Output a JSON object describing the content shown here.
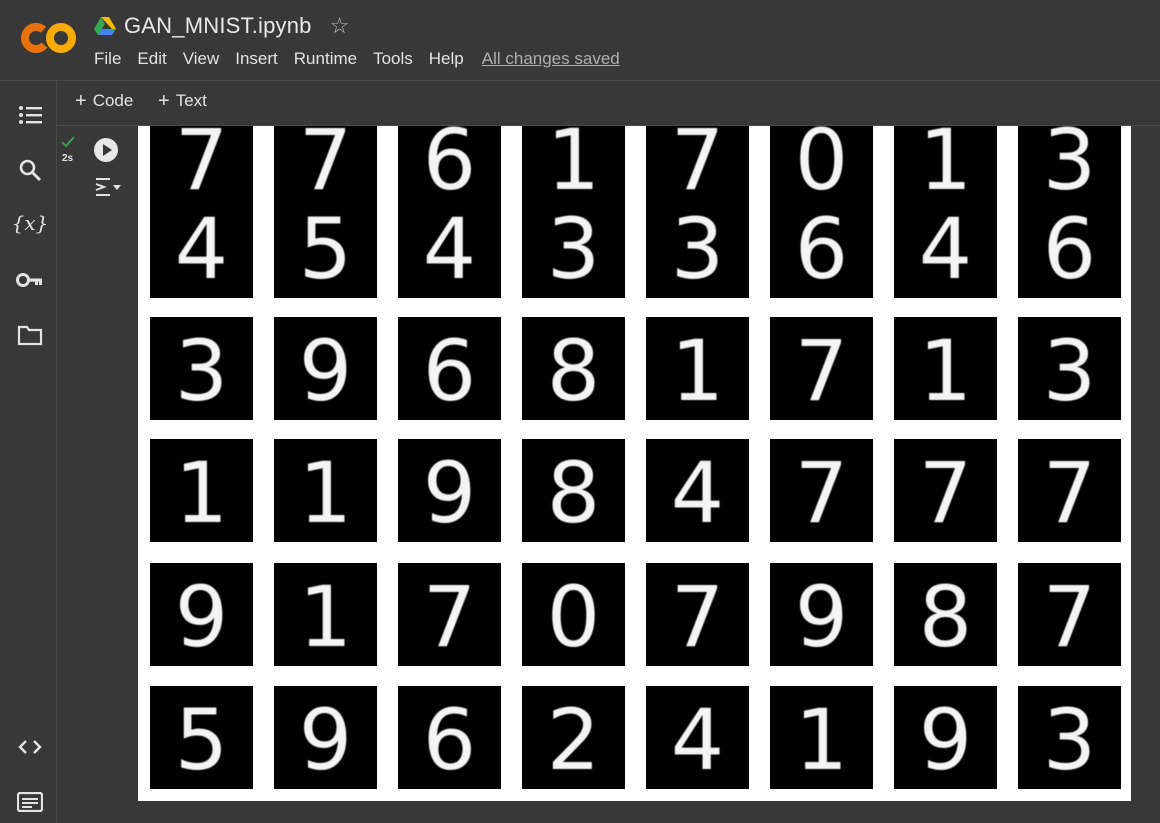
{
  "header": {
    "title": "GAN_MNIST.ipynb",
    "menu": [
      "File",
      "Edit",
      "View",
      "Insert",
      "Runtime",
      "Tools",
      "Help"
    ],
    "save_status": "All changes saved"
  },
  "sidebar": {
    "icons": [
      "table-of-contents-icon",
      "search-icon",
      "variables-icon",
      "secrets-key-icon",
      "files-folder-icon",
      "code-snippets-icon",
      "terminal-icon"
    ],
    "variables_label": "{x}"
  },
  "toolbar": {
    "code_label": "Code",
    "text_label": "Text",
    "plus": "+"
  },
  "cell": {
    "status_icon": "check-icon",
    "exec_time": "2s"
  },
  "output": {
    "grid_digits": [
      [
        "7",
        "7",
        "6",
        "1",
        "7",
        "0",
        "1",
        "3"
      ],
      [
        "4",
        "5",
        "4",
        "3",
        "3",
        "6",
        "4",
        "6"
      ],
      [
        "3",
        "9",
        "6",
        "8",
        "1",
        "7",
        "1",
        "3"
      ],
      [
        "1",
        "1",
        "9",
        "8",
        "4",
        "7",
        "7",
        "7"
      ],
      [
        "9",
        "1",
        "7",
        "0",
        "7",
        "9",
        "8",
        "7"
      ],
      [
        "5",
        "9",
        "6",
        "2",
        "4",
        "1",
        "9",
        "3"
      ]
    ]
  },
  "colors": {
    "background": "#383838",
    "logo_orange": "#f9ab00",
    "logo_orange_dark": "#e8710a",
    "check_green": "#34a853"
  }
}
